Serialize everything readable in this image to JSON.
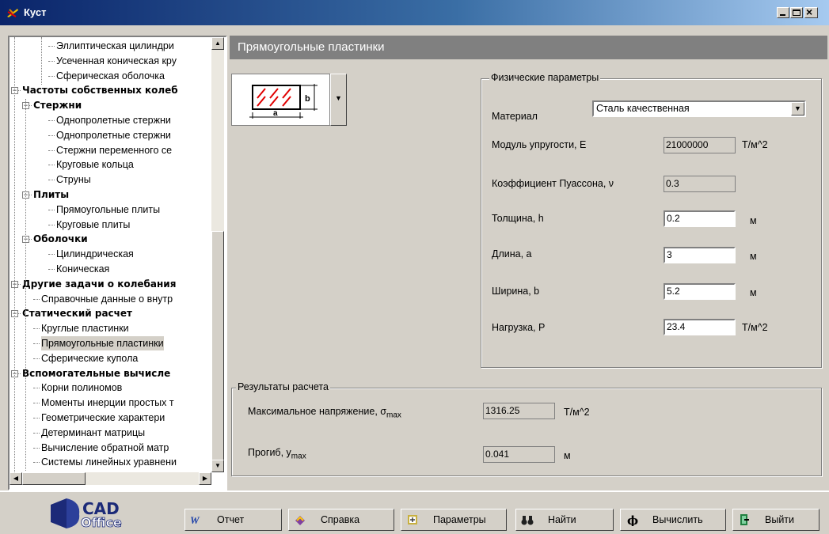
{
  "window": {
    "title": "Куст"
  },
  "tree": {
    "items": [
      {
        "label": "Эллиптическая цилиндри",
        "bold": false
      },
      {
        "label": "Усеченная коническая кру",
        "bold": false
      },
      {
        "label": "Сферическая оболочка",
        "bold": false
      },
      {
        "label": "Частоты собственных колеб",
        "bold": true
      },
      {
        "label": "Стержни",
        "bold": true
      },
      {
        "label": "Однопролетные стержни",
        "bold": false
      },
      {
        "label": "Однопролетные стержни",
        "bold": false
      },
      {
        "label": "Стержни переменного се",
        "bold": false
      },
      {
        "label": "Круговые кольца",
        "bold": false
      },
      {
        "label": "Струны",
        "bold": false
      },
      {
        "label": "Плиты",
        "bold": true
      },
      {
        "label": "Прямоугольные плиты",
        "bold": false
      },
      {
        "label": "Круговые плиты",
        "bold": false
      },
      {
        "label": "Оболочки",
        "bold": true
      },
      {
        "label": "Цилиндрическая",
        "bold": false
      },
      {
        "label": "Коническая",
        "bold": false
      },
      {
        "label": "Другие задачи о колебания",
        "bold": true
      },
      {
        "label": "Справочные данные о внутр",
        "bold": false
      },
      {
        "label": "Статический расчет",
        "bold": true
      },
      {
        "label": "Круглые пластинки",
        "bold": false
      },
      {
        "label": "Прямоугольные пластинки",
        "bold": false,
        "selected": true
      },
      {
        "label": "Сферические купола",
        "bold": false
      },
      {
        "label": "Вспомогательные вычисле",
        "bold": true
      },
      {
        "label": "Корни полиномов",
        "bold": false
      },
      {
        "label": "Моменты инерции простых т",
        "bold": false
      },
      {
        "label": "Геометрические характери",
        "bold": false
      },
      {
        "label": "Детерминант матрицы",
        "bold": false
      },
      {
        "label": "Вычисление обратной матр",
        "bold": false
      },
      {
        "label": "Системы линейных уравнени",
        "bold": false
      }
    ]
  },
  "header": {
    "title": "Прямоугольные пластинки"
  },
  "scheme": {
    "label_a": "a",
    "label_b": "b"
  },
  "physical": {
    "group_label": "Физические параметры",
    "material_label": "Материал",
    "material_value": "Сталь качественная",
    "modulus_label": "Модуль упругости, E",
    "modulus_value": "21000000",
    "modulus_unit": "Т/м^2",
    "poisson_label": "Коэффициент Пуассона, ν",
    "poisson_value": "0.3",
    "thickness_label": "Толщина, h",
    "thickness_value": "0.2",
    "thickness_unit": "м",
    "length_label": "Длина, a",
    "length_value": "3",
    "length_unit": "м",
    "width_label": "Ширина, b",
    "width_value": "5.2",
    "width_unit": "м",
    "load_label": "Нагрузка, P",
    "load_value": "23.4",
    "load_unit": "Т/м^2"
  },
  "results": {
    "group_label": "Результаты расчета",
    "stress_label": "Максимальное напряжение, σ",
    "stress_sub": "max",
    "stress_value": "1316.25",
    "stress_unit": "Т/м^2",
    "deflection_label": "Прогиб, y",
    "deflection_sub": "max",
    "deflection_value": "0.041",
    "deflection_unit": "м"
  },
  "logo": {
    "text_top": "CAD",
    "text_bottom": "Office"
  },
  "toolbar": {
    "report": "Отчет",
    "help": "Справка",
    "params": "Параметры",
    "find": "Найти",
    "calculate": "Вычислить",
    "exit": "Выйти"
  },
  "colors": {
    "title_bar": "#0a246a",
    "header_strip": "#808080",
    "panel": "#d4d0c8",
    "scheme_red": "#e00000"
  }
}
